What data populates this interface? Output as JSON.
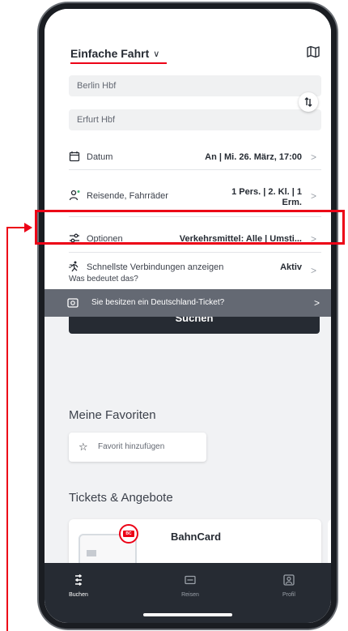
{
  "header": {
    "trip_type": "Einfache Fahrt",
    "chevron": "∨",
    "map_icon": "map-icon"
  },
  "stations": {
    "from": "Berlin Hbf",
    "to": "Erfurt Hbf",
    "swap_icon": "swap-icon"
  },
  "rows": {
    "date": {
      "label": "Datum",
      "value": "An | Mi. 26. März, 17:00",
      "arrow": ">"
    },
    "travellers": {
      "label": "Reisende, Fahrräder",
      "value_line1": "1 Pers. | 2. Kl. | 1",
      "value_line2": "Erm.",
      "arrow": ">"
    },
    "options": {
      "label": "Optionen",
      "value": "Verkehrsmittel: Alle | Umsti...",
      "arrow": ">"
    },
    "fast": {
      "label": "Schnellste Verbindungen anzeigen",
      "value": "Aktiv",
      "arrow": ">"
    },
    "faq": "Was bedeutet das?"
  },
  "search_button": "Suchen",
  "dt_banner": {
    "text": "Sie besitzen ein Deutschland-Ticket?",
    "arrow": ">"
  },
  "favourites": {
    "title": "Meine Favoriten",
    "add_label": "Favorit hinzufügen",
    "star": "☆"
  },
  "tickets": {
    "title": "Tickets & Angebote",
    "card_title": "BahnCard",
    "badge": "BC"
  },
  "tabbar": {
    "tabs": [
      {
        "label": "Buchen",
        "icon": "route-icon",
        "active": true
      },
      {
        "label": "Reisen",
        "icon": "ticket-icon",
        "active": false
      },
      {
        "label": "Profil",
        "icon": "profile-icon",
        "active": false
      }
    ]
  },
  "colors": {
    "brand_red": "#ec0016",
    "dark": "#262b33",
    "banner": "#646973",
    "annotation": "#ec0016"
  }
}
